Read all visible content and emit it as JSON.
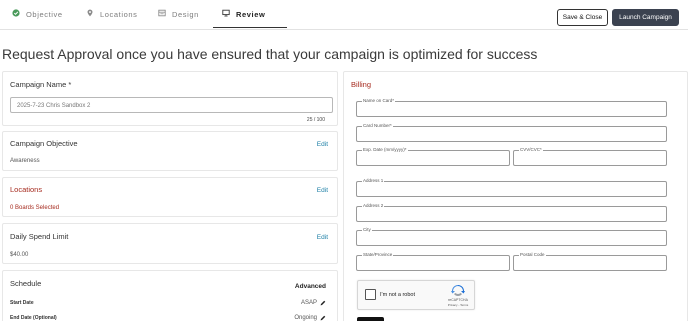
{
  "tabs": [
    {
      "label": "Objective",
      "icon": "check-circle-icon"
    },
    {
      "label": "Locations",
      "icon": "map-pin-icon"
    },
    {
      "label": "Design",
      "icon": "layout-icon"
    },
    {
      "label": "Review",
      "icon": "monitor-icon"
    }
  ],
  "actions": {
    "save_close": "Save & Close",
    "launch": "Launch Campaign"
  },
  "headline": "Request Approval once you have ensured that your campaign is optimized for success",
  "campaign_name": {
    "title": "Campaign Name *",
    "value": "2025-7-23 Chris Sandbox 2",
    "counter": "25 / 100"
  },
  "objective": {
    "title": "Campaign Objective",
    "value": "Awareness",
    "edit": "Edit"
  },
  "locations": {
    "title": "Locations",
    "value": "0 Boards Selected",
    "edit": "Edit"
  },
  "spend": {
    "title": "Daily Spend Limit",
    "value": "$40.00",
    "edit": "Edit"
  },
  "schedule": {
    "title": "Schedule",
    "advanced": "Advanced",
    "start_label": "Start Date",
    "start_value": "ASAP",
    "end_label": "End Date (Optional)",
    "end_value": "Ongoing"
  },
  "billing": {
    "title": "Billing",
    "fields": {
      "name": "Name on Card*",
      "card": "Card Number*",
      "exp": "Exp. Date (mm/yyyy)*",
      "cvv": "CVV/CVC*",
      "addr1": "Address 1",
      "addr2": "Address 2",
      "city": "City",
      "state": "State/Province",
      "postal": "Postal Code"
    },
    "captcha": {
      "label": "I'm not a robot",
      "brand": "reCAPTCHA",
      "terms": "Privacy - Terms"
    }
  },
  "colors": {
    "accent_red": "#a62b1f",
    "edit_blue": "#1c7fa6",
    "launch_bg": "#3b4250"
  }
}
